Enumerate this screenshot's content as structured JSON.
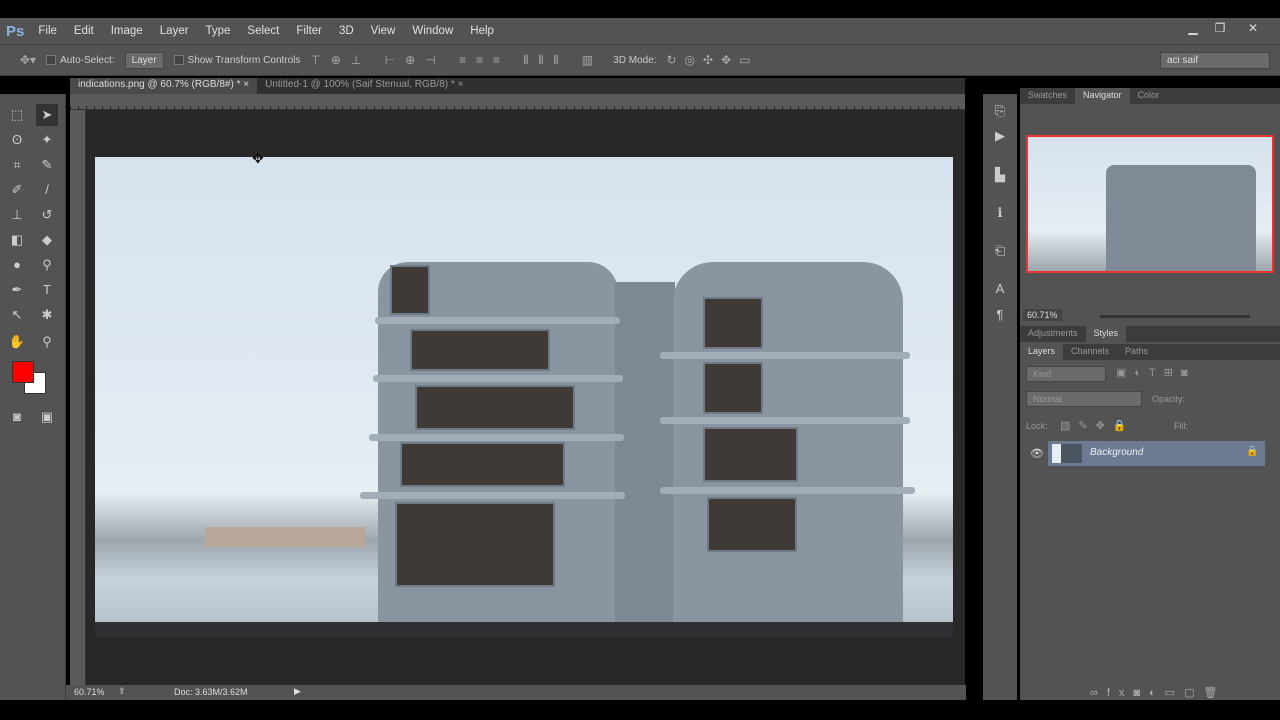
{
  "app": {
    "logo": "Ps"
  },
  "menu": [
    "File",
    "Edit",
    "Image",
    "Layer",
    "Type",
    "Select",
    "Filter",
    "3D",
    "View",
    "Window",
    "Help"
  ],
  "window_controls": {
    "minimize": "▁",
    "restore": "❐",
    "close": "✕"
  },
  "options": {
    "auto_select": "Auto-Select:",
    "auto_select_target": "Layer",
    "show_transform": "Show Transform Controls",
    "mode_3d": "3D Mode:",
    "workspace": "aci saif"
  },
  "tabs": [
    {
      "label": "indications.png @ 60.7% (RGB/8#) *",
      "close": "×"
    },
    {
      "label": "Untitled-1 @ 100% (Saif Stenual, RGB/8) *",
      "close": "×"
    }
  ],
  "status": {
    "zoom": "60.71%",
    "doc": "Doc: 3.63M/3.62M"
  },
  "navigator": {
    "tabs": [
      "Swatches",
      "Navigator",
      "Color"
    ],
    "zoom": "60.71%"
  },
  "adjust_tabs": [
    "Adjustments",
    "Styles"
  ],
  "layers": {
    "tabs": [
      "Layers",
      "Channels",
      "Paths"
    ],
    "filter": "Kind",
    "blend": "Normal",
    "opacity_label": "Opacity:",
    "lock_label": "Lock:",
    "fill_label": "Fill:",
    "layer_name": "Background"
  },
  "colors": {
    "foreground": "#ff0000",
    "background": "#ffffff"
  }
}
